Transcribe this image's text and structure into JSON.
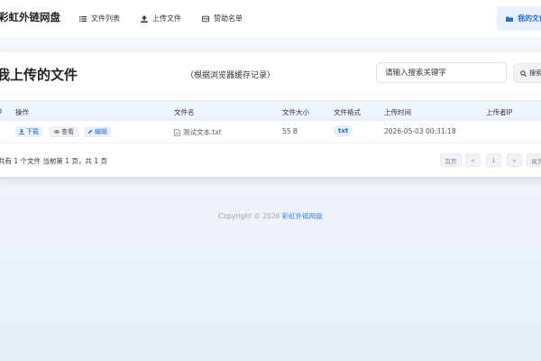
{
  "nav": {
    "brand": "彩虹外链网盘",
    "items": [
      {
        "label": "文件列表",
        "icon": "list-icon"
      },
      {
        "label": "上传文件",
        "icon": "upload-icon"
      },
      {
        "label": "赞助名单",
        "icon": "id-card-icon"
      }
    ],
    "my_files": "我的文件"
  },
  "card": {
    "title": "我上传的文件",
    "subtitle": "（根据浏览器缓存记录）",
    "search_placeholder": "请输入搜索关键字",
    "search_button": "搜索"
  },
  "table": {
    "columns": [
      "ID",
      "操作",
      "文件名",
      "文件大小",
      "文件格式",
      "上传时间",
      "上传者IP"
    ],
    "rows": [
      {
        "actions": {
          "download": "下载",
          "view": "查看",
          "edit": "编辑"
        },
        "filename": "测试文本.txt",
        "size": "55 B",
        "format": "txt",
        "upload_time": "2026-05-03 00:31:18",
        "ip": ""
      }
    ]
  },
  "pagination": {
    "summary": "共有 1 个文件  当前第 1 页，共 1 页",
    "first": "首页",
    "prev": "«",
    "current": "1",
    "next": "»",
    "last": "尾页"
  },
  "footer": {
    "prefix": "Copyright © 2026 ",
    "link": "彩虹外链网盘"
  },
  "colors": {
    "accent": "#2a6fc9",
    "header_bg": "#eef4fc"
  }
}
